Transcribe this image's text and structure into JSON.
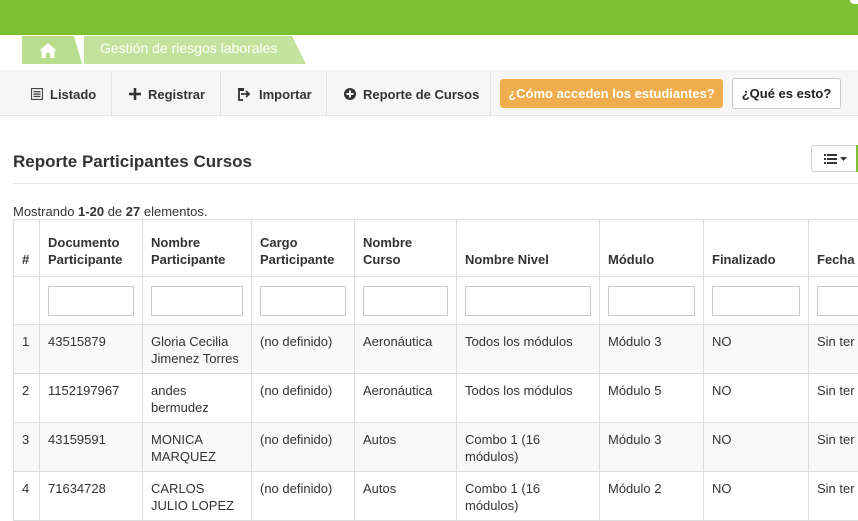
{
  "colors": {
    "brand_green": "#7cc133",
    "orange_button": "#f0ad4e"
  },
  "breadcrumb": {
    "home_icon": "home-icon",
    "current": "Gestión de riesgos laborales"
  },
  "toolbar": {
    "listado": {
      "label": "Listado",
      "icon": "list-icon"
    },
    "registrar": {
      "label": "Registrar",
      "icon": "plus-icon"
    },
    "importar": {
      "label": "Importar",
      "icon": "import-icon"
    },
    "reporte": {
      "label": "Reporte de Cursos",
      "icon": "circle-plus-icon"
    },
    "como_acceden": "¿Cómo acceden los estudiantes?",
    "que_es": "¿Qué es esto?"
  },
  "page": {
    "title": "Reporte Participantes Cursos",
    "summary": {
      "prefix": "Mostrando ",
      "range": "1-20",
      "middle": " de ",
      "total": "27",
      "suffix": " elementos."
    }
  },
  "table": {
    "columns": [
      "#",
      "Documento Participante",
      "Nombre Participante",
      "Cargo Participante",
      "Nombre Curso",
      "Nombre Nivel",
      "Módulo",
      "Finalizado",
      "Fecha"
    ],
    "filters": [
      "",
      "",
      "",
      "",
      "",
      "",
      "",
      ""
    ],
    "rows": [
      [
        "1",
        "43515879",
        "Gloria Cecilia Jimenez Torres",
        "(no definido)",
        "Aeronáutica",
        "Todos los módulos",
        "Módulo 3",
        "NO",
        "Sin ter"
      ],
      [
        "2",
        "1152197967",
        "andes bermudez",
        "(no definido)",
        "Aeronáutica",
        "Todos los módulos",
        "Módulo 5",
        "NO",
        "Sin ter"
      ],
      [
        "3",
        "43159591",
        "MONICA MARQUEZ",
        "(no definido)",
        "Autos",
        "Combo 1 (16 módulos)",
        "Módulo 3",
        "NO",
        "Sin ter"
      ],
      [
        "4",
        "71634728",
        "CARLOS JULIO LOPEZ",
        "(no definido)",
        "Autos",
        "Combo 1 (16 módulos)",
        "Módulo 2",
        "NO",
        "Sin ter"
      ]
    ]
  }
}
